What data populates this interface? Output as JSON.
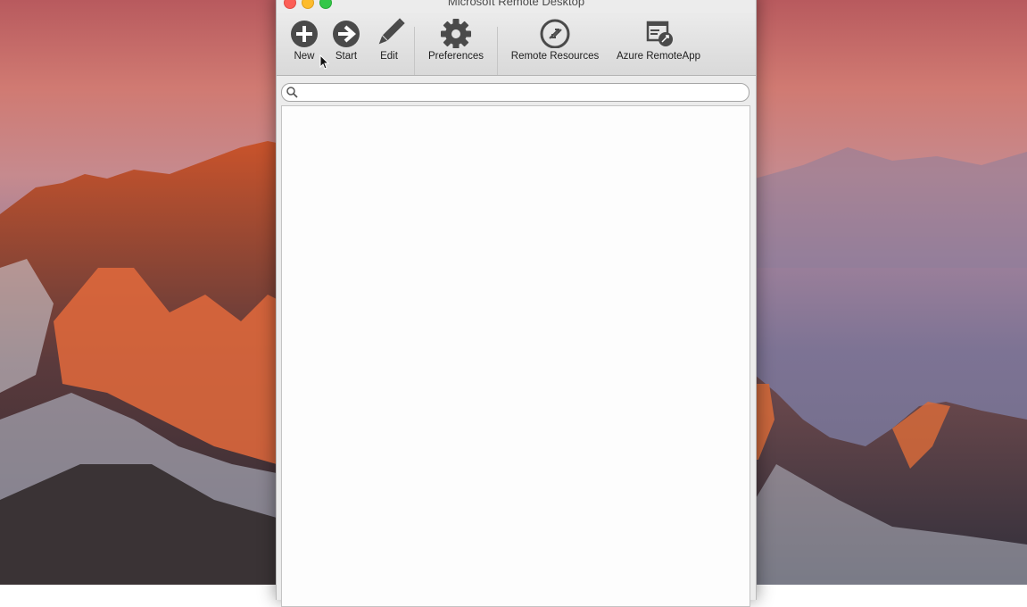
{
  "window": {
    "title": "Microsoft Remote Desktop",
    "traffic_lights": [
      "close",
      "minimize",
      "zoom"
    ]
  },
  "toolbar": {
    "new_label": "New",
    "start_label": "Start",
    "edit_label": "Edit",
    "preferences_label": "Preferences",
    "remote_resources_label": "Remote Resources",
    "azure_label": "Azure RemoteApp"
  },
  "icons": {
    "new": "plus-circle-icon",
    "start": "arrow-right-circle-icon",
    "edit": "pencil-icon",
    "preferences": "gear-icon",
    "remote_resources": "remote-resources-icon",
    "azure": "azure-remoteapp-icon",
    "search": "search-icon"
  },
  "search": {
    "value": "",
    "placeholder": ""
  },
  "colors": {
    "close": "#fc5f57",
    "minimize": "#fdbc2e",
    "zoom": "#33c748",
    "icon": "#4a4a4a"
  }
}
